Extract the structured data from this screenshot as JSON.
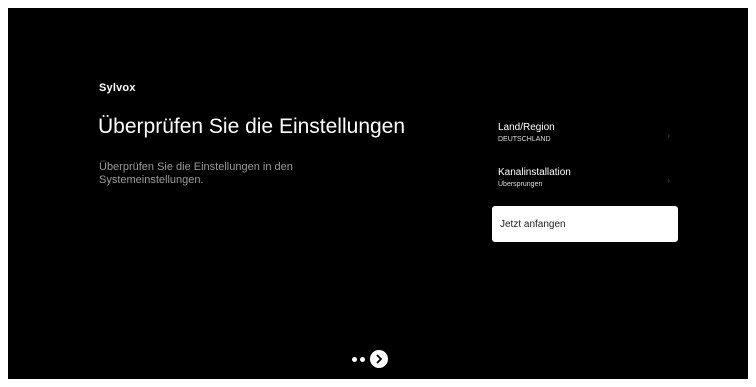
{
  "brand": "Sylvox",
  "title": "Überprüfen Sie die Einstellungen",
  "subtitle": "Überprüfen Sie die Einstellungen in den Systemeinstellungen.",
  "settings": [
    {
      "label": "Land/Region",
      "value": "DEUTSCHLAND",
      "icon": "chevron-right-icon"
    },
    {
      "label": "Kanalinstallation",
      "value": "Übersprungen",
      "icon": "chevron-right-icon"
    }
  ],
  "start_button": "Jetzt anfangen",
  "pager": {
    "dots": 2,
    "next_icon": "arrow-right-circle-icon"
  },
  "colors": {
    "background": "#000000",
    "text": "#ffffff",
    "subtext": "#9a9a9a",
    "selected": "#ffffff"
  }
}
